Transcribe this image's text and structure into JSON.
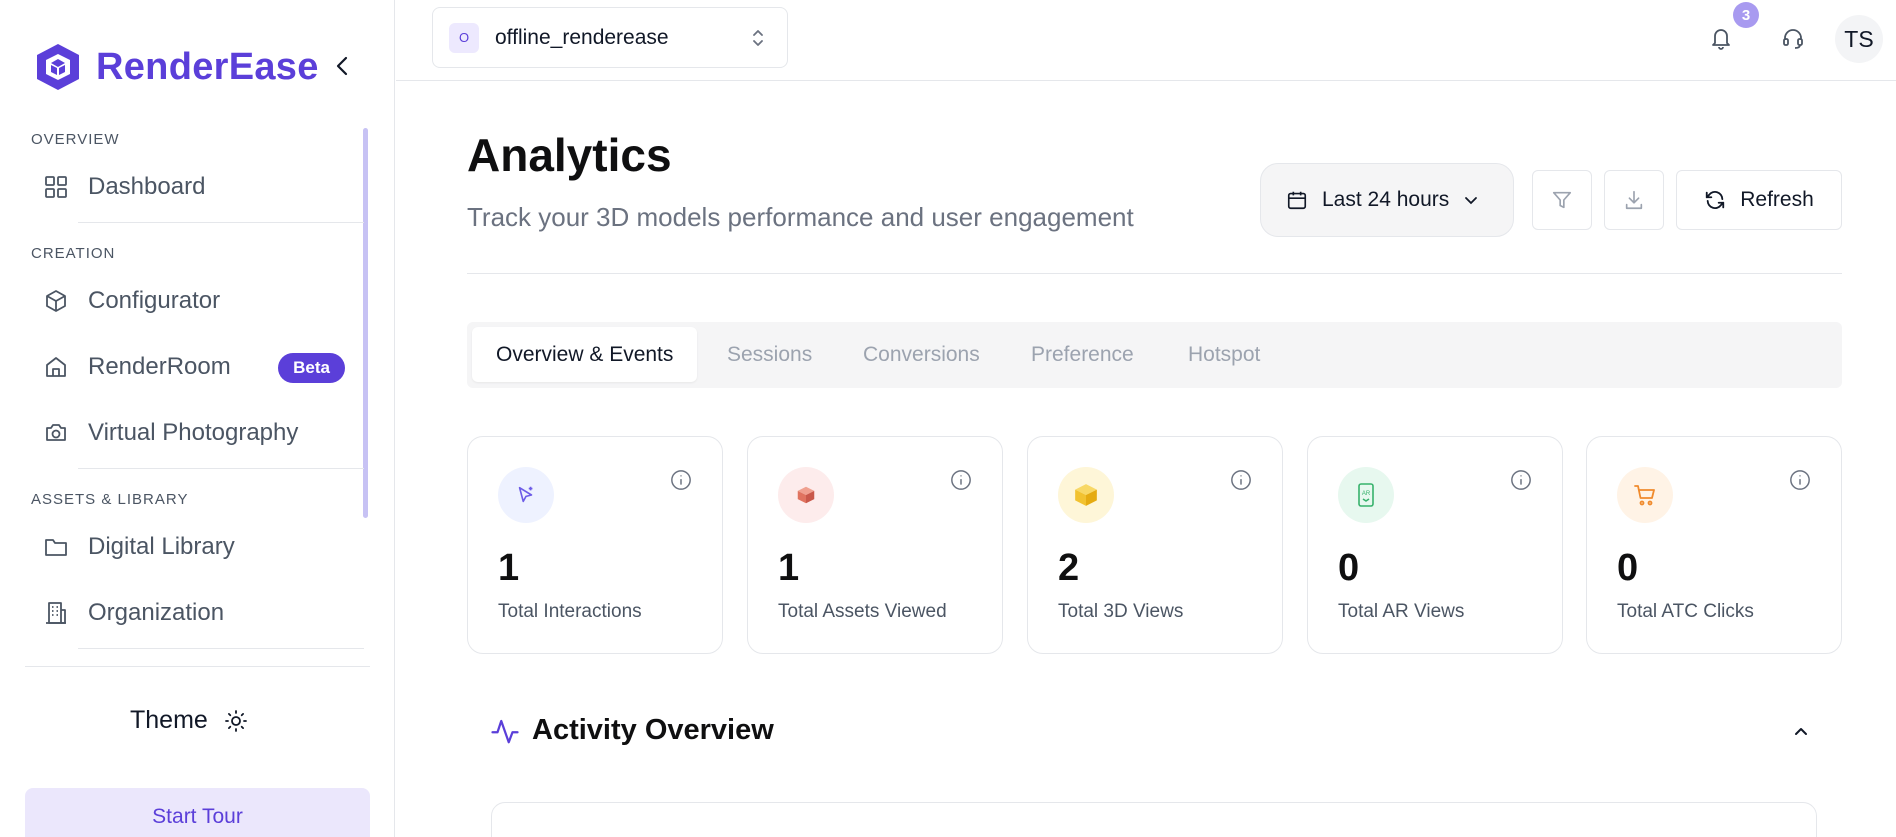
{
  "brand": {
    "name": "RenderEase",
    "color": "#5b3fd9"
  },
  "sidebar": {
    "sections": [
      {
        "label": "OVERVIEW"
      },
      {
        "label": "CREATION"
      },
      {
        "label": "ASSETS & LIBRARY"
      }
    ],
    "items": [
      {
        "label": "Dashboard",
        "icon": "grid-icon"
      },
      {
        "label": "Configurator",
        "icon": "cube-icon"
      },
      {
        "label": "RenderRoom",
        "icon": "home-icon",
        "badge": "Beta"
      },
      {
        "label": "Virtual Photography",
        "icon": "camera-icon"
      },
      {
        "label": "Digital Library",
        "icon": "folder-icon"
      },
      {
        "label": "Organization",
        "icon": "building-icon"
      }
    ],
    "theme_label": "Theme",
    "tour_label": "Start Tour"
  },
  "topbar": {
    "org_initial": "O",
    "org_name": "offline_renderease",
    "notification_count": "3",
    "avatar_initials": "TS"
  },
  "page": {
    "title": "Analytics",
    "subtitle": "Track your 3D models performance and user engagement",
    "range_label": "Last 24 hours",
    "refresh_label": "Refresh"
  },
  "tabs": [
    {
      "label": "Overview & Events",
      "active": true
    },
    {
      "label": "Sessions"
    },
    {
      "label": "Conversions"
    },
    {
      "label": "Preference"
    },
    {
      "label": "Hotspot"
    }
  ],
  "stats": [
    {
      "value": "1",
      "label": "Total Interactions",
      "icon": "cursor-icon",
      "bg": "#eef2ff",
      "color": "#6d5ce7"
    },
    {
      "value": "1",
      "label": "Total Assets Viewed",
      "icon": "box-icon",
      "bg": "#fdecec",
      "color": "#e0735f"
    },
    {
      "value": "2",
      "label": "Total 3D Views",
      "icon": "cube-3d-icon",
      "bg": "#fef6d8",
      "color": "#f2c230"
    },
    {
      "value": "0",
      "label": "Total AR Views",
      "icon": "ar-phone-icon",
      "bg": "#e7f8ef",
      "color": "#37b26c"
    },
    {
      "value": "0",
      "label": "Total ATC Clicks",
      "icon": "cart-icon",
      "bg": "#fff3e6",
      "color": "#f08a2c"
    }
  ],
  "activity": {
    "title": "Activity Overview"
  }
}
